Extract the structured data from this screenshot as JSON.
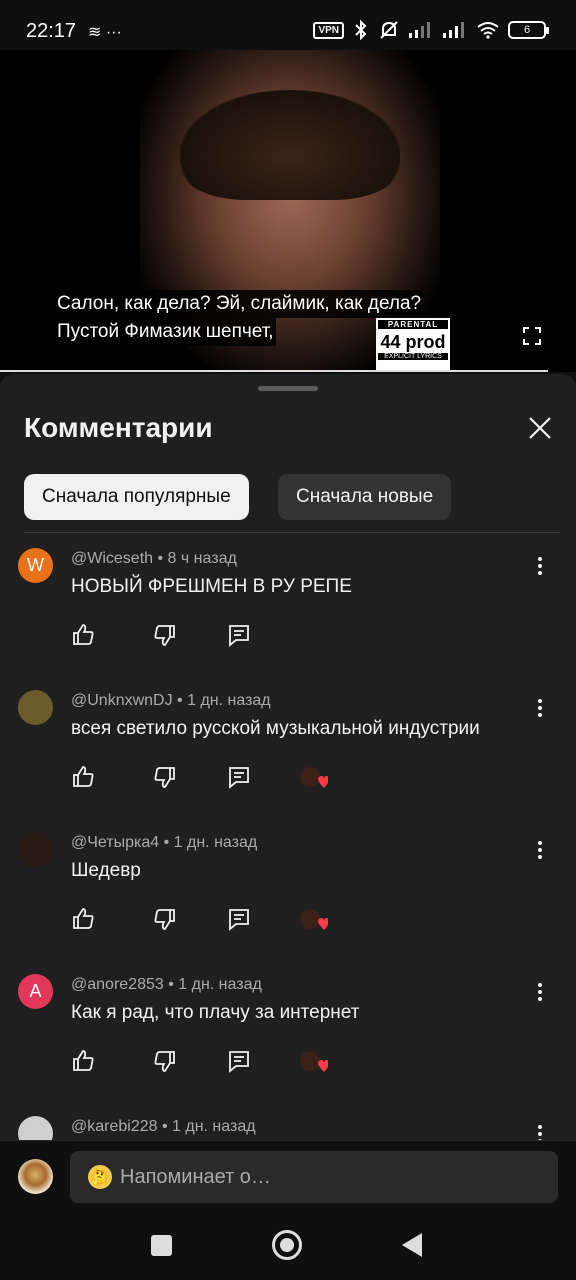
{
  "status_bar": {
    "time": "22:17",
    "left_icons": "≋ ···",
    "vpn": "VPN",
    "battery": "6"
  },
  "video": {
    "subtitle_line1": "Салон, как дела? Эй, слаймик, как дела?",
    "subtitle_line2": "Пустой Фимазик шепчет,",
    "badge_top": "PARENTAL",
    "badge_main": "44 prod",
    "badge_bottom": "EXPLICIT LYRICS"
  },
  "comments_sheet": {
    "title": "Комментарии",
    "filters": [
      {
        "label": "Сначала популярные",
        "active": true
      },
      {
        "label": "Сначала новые",
        "active": false
      }
    ],
    "comments": [
      {
        "author": "@Wiceseth",
        "time": "8 ч назад",
        "text": "НОВЫЙ ФРЕШМЕН В РУ РЕПЕ",
        "avatar_letter": "W",
        "avatar_color": "#e8711a",
        "creator_heart": false
      },
      {
        "author": "@UnknxwnDJ",
        "time": "1 дн. назад",
        "text": "всея светило русской музыкальной индустрии",
        "avatar_letter": "",
        "avatar_color": "#6b5a2a",
        "creator_heart": true
      },
      {
        "author": "@Четырка4",
        "time": "1 дн. назад",
        "text": "Шедевр",
        "avatar_letter": "",
        "avatar_color": "#2a1a14",
        "creator_heart": true
      },
      {
        "author": "@anore2853",
        "time": "1 дн. назад",
        "text": "Как я рад, что плачу за интернет",
        "avatar_letter": "A",
        "avatar_color": "#e3375a",
        "creator_heart": true
      },
      {
        "author": "@karebi228",
        "time": "1 дн. назад",
        "text": "",
        "avatar_letter": "",
        "avatar_color": "#cfcfcf",
        "creator_heart": false
      }
    ]
  },
  "composer": {
    "placeholder": "Напоминает о…",
    "emoji": "🤔"
  },
  "colors": {
    "background": "#0f0f0f",
    "sheet": "#1f1f1f",
    "heart": "#ff3b4a"
  }
}
